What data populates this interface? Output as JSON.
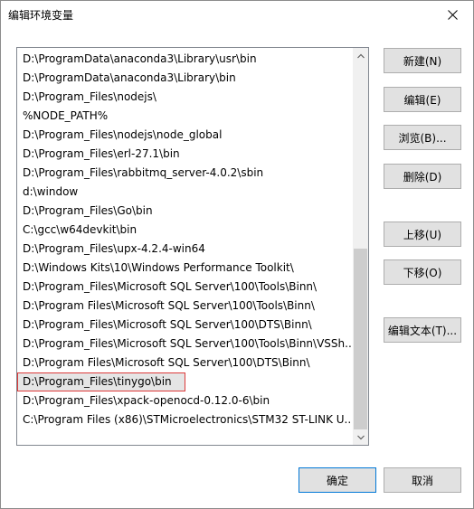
{
  "window": {
    "title": "编辑环境变量"
  },
  "list": {
    "items": [
      "D:\\ProgramData\\anaconda3\\Library\\usr\\bin",
      "D:\\ProgramData\\anaconda3\\Library\\bin",
      "D:\\Program_Files\\nodejs\\",
      "%NODE_PATH%",
      "D:\\Program_Files\\nodejs\\node_global",
      "D:\\Program_Files\\erl-27.1\\bin",
      "D:\\Program_Files\\rabbitmq_server-4.0.2\\sbin",
      "d:\\window",
      "D:\\Program_Files\\Go\\bin",
      "C:\\gcc\\w64devkit\\bin",
      "D:\\Program_Files\\upx-4.2.4-win64",
      "D:\\Windows Kits\\10\\Windows Performance Toolkit\\",
      "D:\\Program_Files\\Microsoft SQL Server\\100\\Tools\\Binn\\",
      "D:\\Program Files\\Microsoft SQL Server\\100\\Tools\\Binn\\",
      "D:\\Program_Files\\Microsoft SQL Server\\100\\DTS\\Binn\\",
      "D:\\Program_Files\\Microsoft SQL Server\\100\\Tools\\Binn\\VSSh...",
      "D:\\Program Files\\Microsoft SQL Server\\100\\DTS\\Binn\\",
      "D:\\Program_Files\\tinygo\\bin",
      "D:\\Program_Files\\xpack-openocd-0.12.0-6\\bin",
      "C:\\Program Files (x86)\\STMicroelectronics\\STM32 ST-LINK U..."
    ],
    "selected_index": 17
  },
  "buttons": {
    "new": "新建(N)",
    "edit": "编辑(E)",
    "browse": "浏览(B)...",
    "delete": "删除(D)",
    "move_up": "上移(U)",
    "move_down": "下移(O)",
    "edit_text": "编辑文本(T)...",
    "ok": "确定",
    "cancel": "取消"
  },
  "icons": {
    "close": "close-icon",
    "scroll_up": "chevron-up-icon",
    "scroll_down": "chevron-down-icon"
  },
  "colors": {
    "primary_border": "#0078d7",
    "selection_outline": "#dd3a3a"
  }
}
